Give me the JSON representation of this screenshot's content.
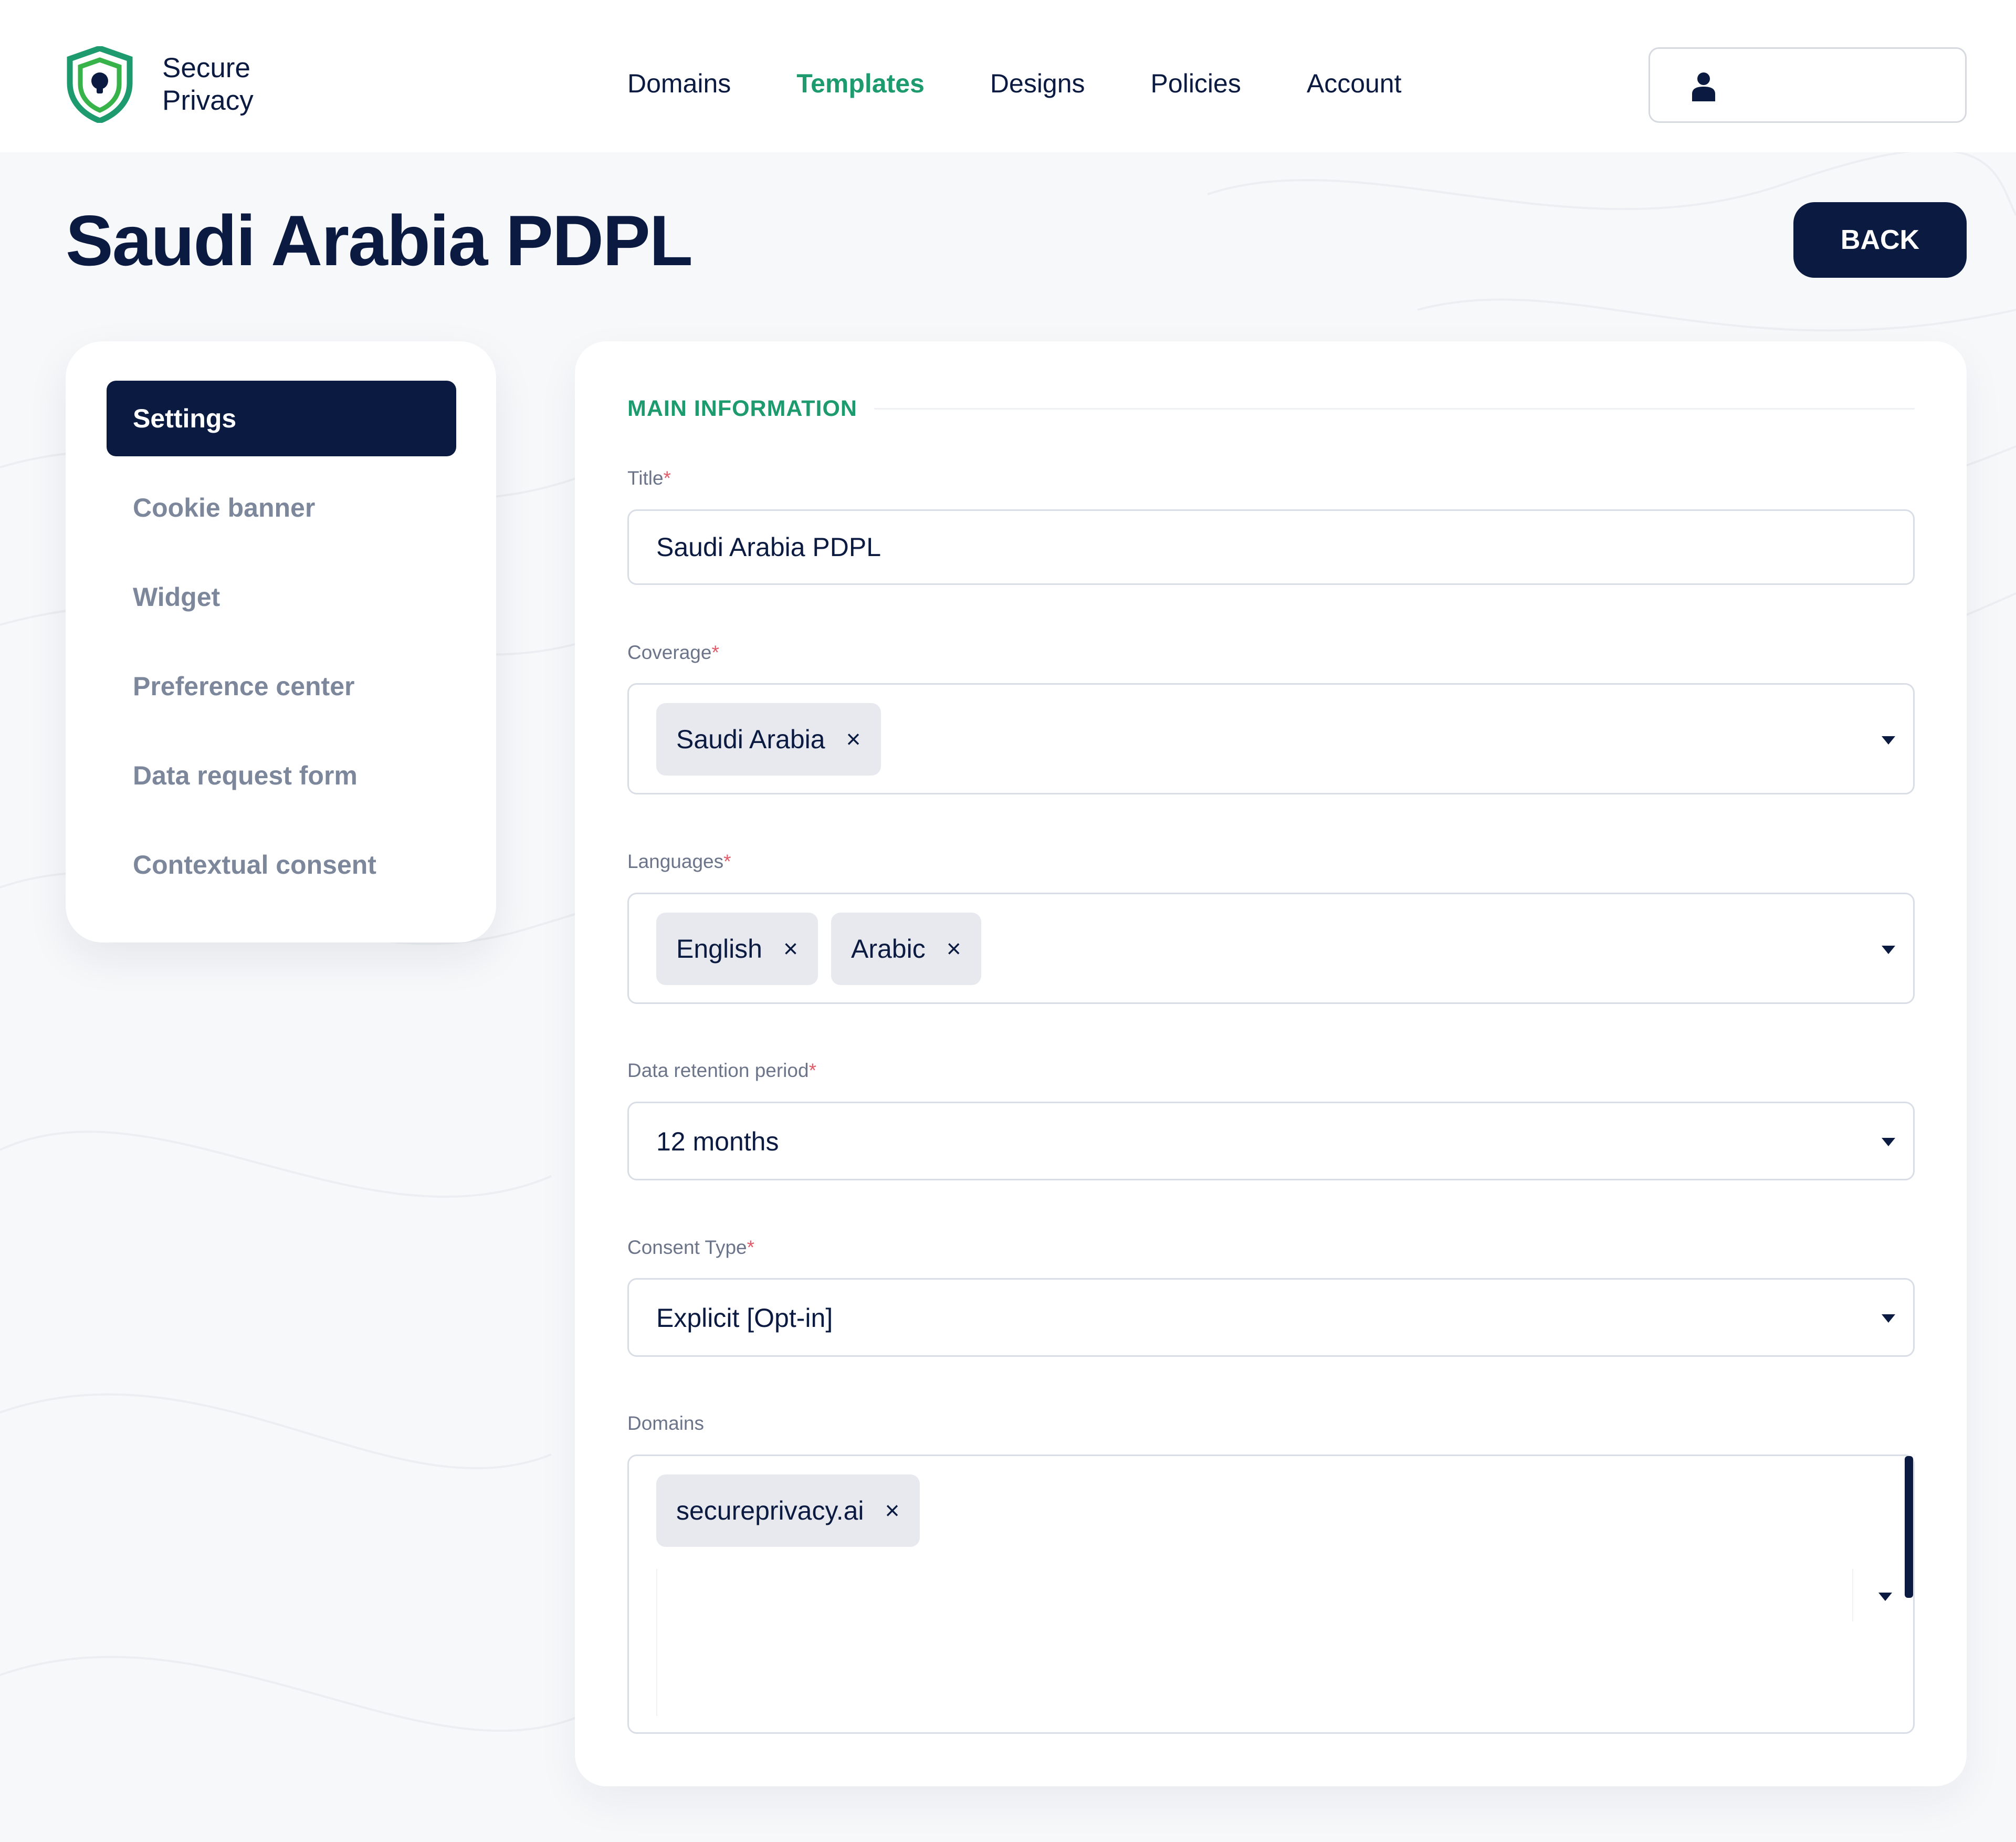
{
  "brand": {
    "name_line1": "Secure",
    "name_line2": "Privacy",
    "accent_color": "#1d9a6e",
    "navy": "#0b1a40"
  },
  "nav": {
    "items": [
      {
        "label": "Domains",
        "active": false
      },
      {
        "label": "Templates",
        "active": true
      },
      {
        "label": "Designs",
        "active": false
      },
      {
        "label": "Policies",
        "active": false
      },
      {
        "label": "Account",
        "active": false
      }
    ]
  },
  "user": {
    "icon": "user-icon"
  },
  "page": {
    "title": "Saudi Arabia PDPL",
    "back_label": "BACK"
  },
  "sidebar": {
    "items": [
      {
        "label": "Settings",
        "active": true
      },
      {
        "label": "Cookie banner",
        "active": false
      },
      {
        "label": "Widget",
        "active": false
      },
      {
        "label": "Preference center",
        "active": false
      },
      {
        "label": "Data request form",
        "active": false
      },
      {
        "label": "Contextual consent",
        "active": false
      }
    ]
  },
  "form": {
    "section_title": "MAIN INFORMATION",
    "required_mark": "*",
    "title": {
      "label": "Title",
      "value": "Saudi Arabia PDPL"
    },
    "coverage": {
      "label": "Coverage",
      "chips": [
        "Saudi Arabia"
      ]
    },
    "languages": {
      "label": "Languages",
      "chips": [
        "English",
        "Arabic"
      ]
    },
    "retention": {
      "label": "Data retention period",
      "value": "12 months"
    },
    "consent_type": {
      "label": "Consent Type",
      "value": "Explicit [Opt-in]"
    },
    "domains": {
      "label": "Domains",
      "chips": [
        "secureprivacy.ai"
      ]
    },
    "chip_remove": "×"
  }
}
